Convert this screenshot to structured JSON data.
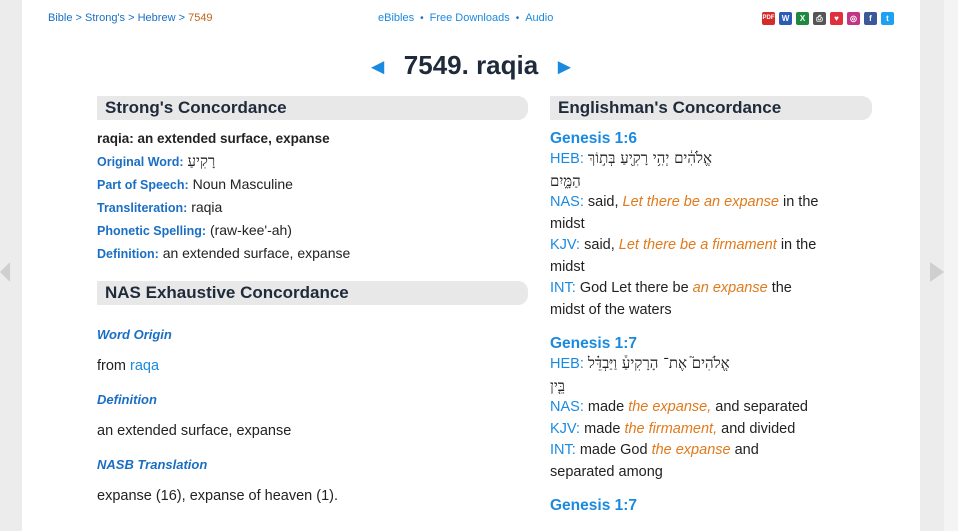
{
  "breadcrumb": {
    "bible": "Bible",
    "strongs": "Strong's",
    "hebrew": "Hebrew",
    "current": "7549",
    "sep": ">"
  },
  "toplinks": {
    "ebibles": "eBibles",
    "downloads": "Free Downloads",
    "audio": "Audio",
    "dot": "•"
  },
  "social": [
    {
      "name": "pdf-icon",
      "text": "PDF",
      "color": "#d62b2b"
    },
    {
      "name": "word-icon",
      "text": "W",
      "color": "#2b5bb5"
    },
    {
      "name": "excel-icon",
      "text": "X",
      "color": "#1f8a3f"
    },
    {
      "name": "printer-icon",
      "text": "⎙",
      "color": "#555555"
    },
    {
      "name": "heart-icon",
      "text": "♥",
      "color": "#e0303c"
    },
    {
      "name": "instagram-icon",
      "text": "◎",
      "color": "#c13584"
    },
    {
      "name": "facebook-icon",
      "text": "f",
      "color": "#3b5998"
    },
    {
      "name": "twitter-icon",
      "text": "t",
      "color": "#1da1f2"
    }
  ],
  "title": {
    "prev": "◄",
    "text": "7549. raqia",
    "next": "►"
  },
  "strongs": {
    "heading": "Strong's Concordance",
    "summary": "raqia: an extended surface, expanse",
    "original_word_label": "Original Word:",
    "original_word": "רָקִיעַ",
    "pos_label": "Part of Speech:",
    "pos": "Noun Masculine",
    "translit_label": "Transliteration:",
    "translit": "raqia",
    "phonetic_label": "Phonetic Spelling:",
    "phonetic": "(raw-kee'-ah)",
    "definition_label": "Definition:",
    "definition": "an extended surface, expanse"
  },
  "nas": {
    "heading": "NAS Exhaustive Concordance",
    "word_origin_label": "Word Origin",
    "from": "from",
    "from_link": "raqa",
    "definition_label": "Definition",
    "definition": "an extended surface, expanse",
    "nasb_label": "NASB Translation",
    "nasb": "expanse (16), expanse of heaven (1)."
  },
  "englishman": {
    "heading": "Englishman's Concordance",
    "verses": [
      {
        "ref": "Genesis 1:6",
        "heb_label": "HEB:",
        "heb_1": "אֱלֹהִ֔ים יְהִ֥י רָקִ֖יעַ בְּת֣וֹךְ",
        "heb_2": "הַמָּ֑יִם",
        "nas_label": "NAS:",
        "nas_pre": "said,",
        "nas_hi": "Let there be an expanse",
        "nas_post": "in the",
        "nas_line2": "midst",
        "kjv_label": "KJV:",
        "kjv_pre": "said,",
        "kjv_hi": "Let there be a firmament",
        "kjv_post": "in the",
        "kjv_line2": "midst",
        "int_label": "INT:",
        "int_pre": "God Let there be",
        "int_hi": "an expanse",
        "int_post": "the",
        "int_line2": "midst of the waters"
      },
      {
        "ref": "Genesis 1:7",
        "heb_label": "HEB:",
        "heb_1": "אֱלֹהִים֮ אֶת־ הָרָקִיעַ֒ וַיַּבְדֵּ֗ל",
        "heb_2": "בֵּ֤ין",
        "nas_label": "NAS:",
        "nas_pre": "made",
        "nas_hi": "the expanse,",
        "nas_post": "and separated",
        "kjv_label": "KJV:",
        "kjv_pre": "made",
        "kjv_hi": "the firmament,",
        "kjv_post": "and divided",
        "int_label": "INT:",
        "int_pre": "made God",
        "int_hi": "the expanse",
        "int_post": "and",
        "int_line2": "separated among"
      },
      {
        "ref": "Genesis 1:7"
      }
    ]
  }
}
